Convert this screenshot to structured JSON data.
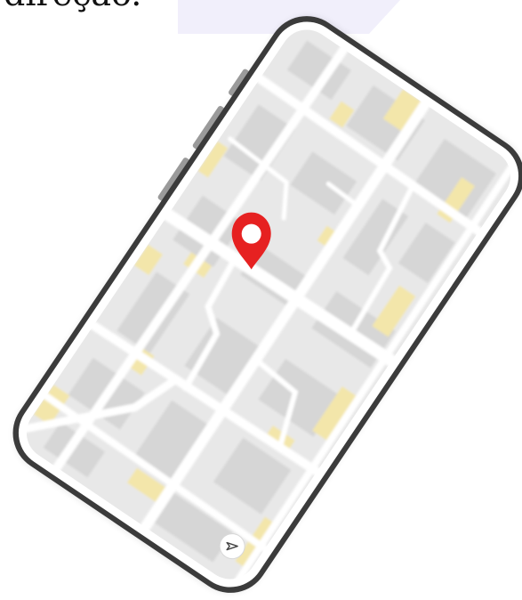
{
  "caption": "direção.",
  "colors": {
    "map_background": "#e8e8e8",
    "road": "#ffffff",
    "building_block": "#d6d6d6",
    "highlight_building": "#f3e6aa",
    "pin": "#e62121",
    "phone_frame": "#3b3b3b",
    "phone_bezel": "#ffffff",
    "lavender_band": "#f1effb"
  },
  "phone": {
    "map_marker_icon": "location-pin-icon",
    "navigate_button_icon": "navigation-arrow-icon"
  }
}
